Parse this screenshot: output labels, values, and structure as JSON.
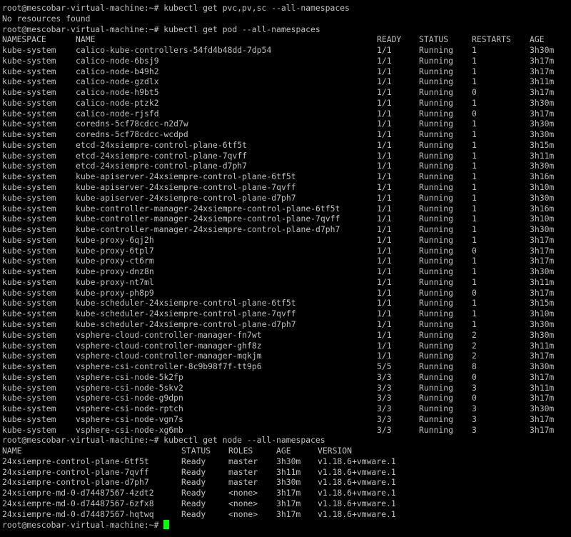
{
  "colors": {
    "background": "#000000",
    "foreground": "#c0c0c0",
    "cursor": "#00ff00"
  },
  "session": {
    "line1": "root@mescobar-virtual-machine:~# kubectl get pvc,pv,sc --all-namespaces",
    "line2": "No resources found",
    "line3": "root@mescobar-virtual-machine:~# kubectl get pod --all-namespaces",
    "node_cmd": "root@mescobar-virtual-machine:~# kubectl get node --all-namespaces",
    "final_prompt": "root@mescobar-virtual-machine:~# "
  },
  "pods": {
    "headers": [
      "NAMESPACE",
      "NAME",
      "READY",
      "STATUS",
      "RESTARTS",
      "AGE"
    ],
    "rows": [
      [
        "kube-system",
        "calico-kube-controllers-54fd4b48dd-7dp54",
        "1/1",
        "Running",
        "1",
        "3h30m"
      ],
      [
        "kube-system",
        "calico-node-6bsj9",
        "1/1",
        "Running",
        "1",
        "3h17m"
      ],
      [
        "kube-system",
        "calico-node-b49h2",
        "1/1",
        "Running",
        "1",
        "3h17m"
      ],
      [
        "kube-system",
        "calico-node-gzdlx",
        "1/1",
        "Running",
        "1",
        "3h11m"
      ],
      [
        "kube-system",
        "calico-node-h9bt5",
        "1/1",
        "Running",
        "0",
        "3h17m"
      ],
      [
        "kube-system",
        "calico-node-ptzk2",
        "1/1",
        "Running",
        "1",
        "3h30m"
      ],
      [
        "kube-system",
        "calico-node-rjsfd",
        "1/1",
        "Running",
        "0",
        "3h17m"
      ],
      [
        "kube-system",
        "coredns-5cf78cdcc-n2d7w",
        "1/1",
        "Running",
        "1",
        "3h30m"
      ],
      [
        "kube-system",
        "coredns-5cf78cdcc-wcdpd",
        "1/1",
        "Running",
        "1",
        "3h30m"
      ],
      [
        "kube-system",
        "etcd-24xsiempre-control-plane-6tf5t",
        "1/1",
        "Running",
        "1",
        "3h15m"
      ],
      [
        "kube-system",
        "etcd-24xsiempre-control-plane-7qvff",
        "1/1",
        "Running",
        "1",
        "3h11m"
      ],
      [
        "kube-system",
        "etcd-24xsiempre-control-plane-d7ph7",
        "1/1",
        "Running",
        "1",
        "3h30m"
      ],
      [
        "kube-system",
        "kube-apiserver-24xsiempre-control-plane-6tf5t",
        "1/1",
        "Running",
        "1",
        "3h16m"
      ],
      [
        "kube-system",
        "kube-apiserver-24xsiempre-control-plane-7qvff",
        "1/1",
        "Running",
        "1",
        "3h10m"
      ],
      [
        "kube-system",
        "kube-apiserver-24xsiempre-control-plane-d7ph7",
        "1/1",
        "Running",
        "1",
        "3h30m"
      ],
      [
        "kube-system",
        "kube-controller-manager-24xsiempre-control-plane-6tf5t",
        "1/1",
        "Running",
        "1",
        "3h16m"
      ],
      [
        "kube-system",
        "kube-controller-manager-24xsiempre-control-plane-7qvff",
        "1/1",
        "Running",
        "1",
        "3h10m"
      ],
      [
        "kube-system",
        "kube-controller-manager-24xsiempre-control-plane-d7ph7",
        "1/1",
        "Running",
        "1",
        "3h30m"
      ],
      [
        "kube-system",
        "kube-proxy-6qj2h",
        "1/1",
        "Running",
        "1",
        "3h17m"
      ],
      [
        "kube-system",
        "kube-proxy-6tpl7",
        "1/1",
        "Running",
        "0",
        "3h17m"
      ],
      [
        "kube-system",
        "kube-proxy-ct6rm",
        "1/1",
        "Running",
        "1",
        "3h17m"
      ],
      [
        "kube-system",
        "kube-proxy-dnz8n",
        "1/1",
        "Running",
        "1",
        "3h30m"
      ],
      [
        "kube-system",
        "kube-proxy-nt7ml",
        "1/1",
        "Running",
        "1",
        "3h11m"
      ],
      [
        "kube-system",
        "kube-proxy-ph8p9",
        "1/1",
        "Running",
        "0",
        "3h17m"
      ],
      [
        "kube-system",
        "kube-scheduler-24xsiempre-control-plane-6tf5t",
        "1/1",
        "Running",
        "1",
        "3h15m"
      ],
      [
        "kube-system",
        "kube-scheduler-24xsiempre-control-plane-7qvff",
        "1/1",
        "Running",
        "1",
        "3h10m"
      ],
      [
        "kube-system",
        "kube-scheduler-24xsiempre-control-plane-d7ph7",
        "1/1",
        "Running",
        "1",
        "3h30m"
      ],
      [
        "kube-system",
        "vsphere-cloud-controller-manager-fn7wt",
        "1/1",
        "Running",
        "2",
        "3h30m"
      ],
      [
        "kube-system",
        "vsphere-cloud-controller-manager-ghf8z",
        "1/1",
        "Running",
        "2",
        "3h11m"
      ],
      [
        "kube-system",
        "vsphere-cloud-controller-manager-mqkjm",
        "1/1",
        "Running",
        "2",
        "3h17m"
      ],
      [
        "kube-system",
        "vsphere-csi-controller-8c9b98f7f-tt9p6",
        "5/5",
        "Running",
        "8",
        "3h30m"
      ],
      [
        "kube-system",
        "vsphere-csi-node-5k2fp",
        "3/3",
        "Running",
        "0",
        "3h17m"
      ],
      [
        "kube-system",
        "vsphere-csi-node-5skv2",
        "3/3",
        "Running",
        "3",
        "3h11m"
      ],
      [
        "kube-system",
        "vsphere-csi-node-g9dpn",
        "3/3",
        "Running",
        "0",
        "3h17m"
      ],
      [
        "kube-system",
        "vsphere-csi-node-rptch",
        "3/3",
        "Running",
        "3",
        "3h30m"
      ],
      [
        "kube-system",
        "vsphere-csi-node-vgn7s",
        "3/3",
        "Running",
        "3",
        "3h17m"
      ],
      [
        "kube-system",
        "vsphere-csi-node-xg6mb",
        "3/3",
        "Running",
        "3",
        "3h17m"
      ]
    ]
  },
  "nodes": {
    "headers": [
      "NAME",
      "STATUS",
      "ROLES",
      "AGE",
      "VERSION"
    ],
    "rows": [
      [
        "24xsiempre-control-plane-6tf5t",
        "Ready",
        "master",
        "3h30m",
        "v1.18.6+vmware.1"
      ],
      [
        "24xsiempre-control-plane-7qvff",
        "Ready",
        "master",
        "3h11m",
        "v1.18.6+vmware.1"
      ],
      [
        "24xsiempre-control-plane-d7ph7",
        "Ready",
        "master",
        "3h30m",
        "v1.18.6+vmware.1"
      ],
      [
        "24xsiempre-md-0-d74487567-4zdt2",
        "Ready",
        "<none>",
        "3h17m",
        "v1.18.6+vmware.1"
      ],
      [
        "24xsiempre-md-0-d74487567-6zfx8",
        "Ready",
        "<none>",
        "3h17m",
        "v1.18.6+vmware.1"
      ],
      [
        "24xsiempre-md-0-d74487567-hqtwq",
        "Ready",
        "<none>",
        "3h17m",
        "v1.18.6+vmware.1"
      ]
    ]
  }
}
